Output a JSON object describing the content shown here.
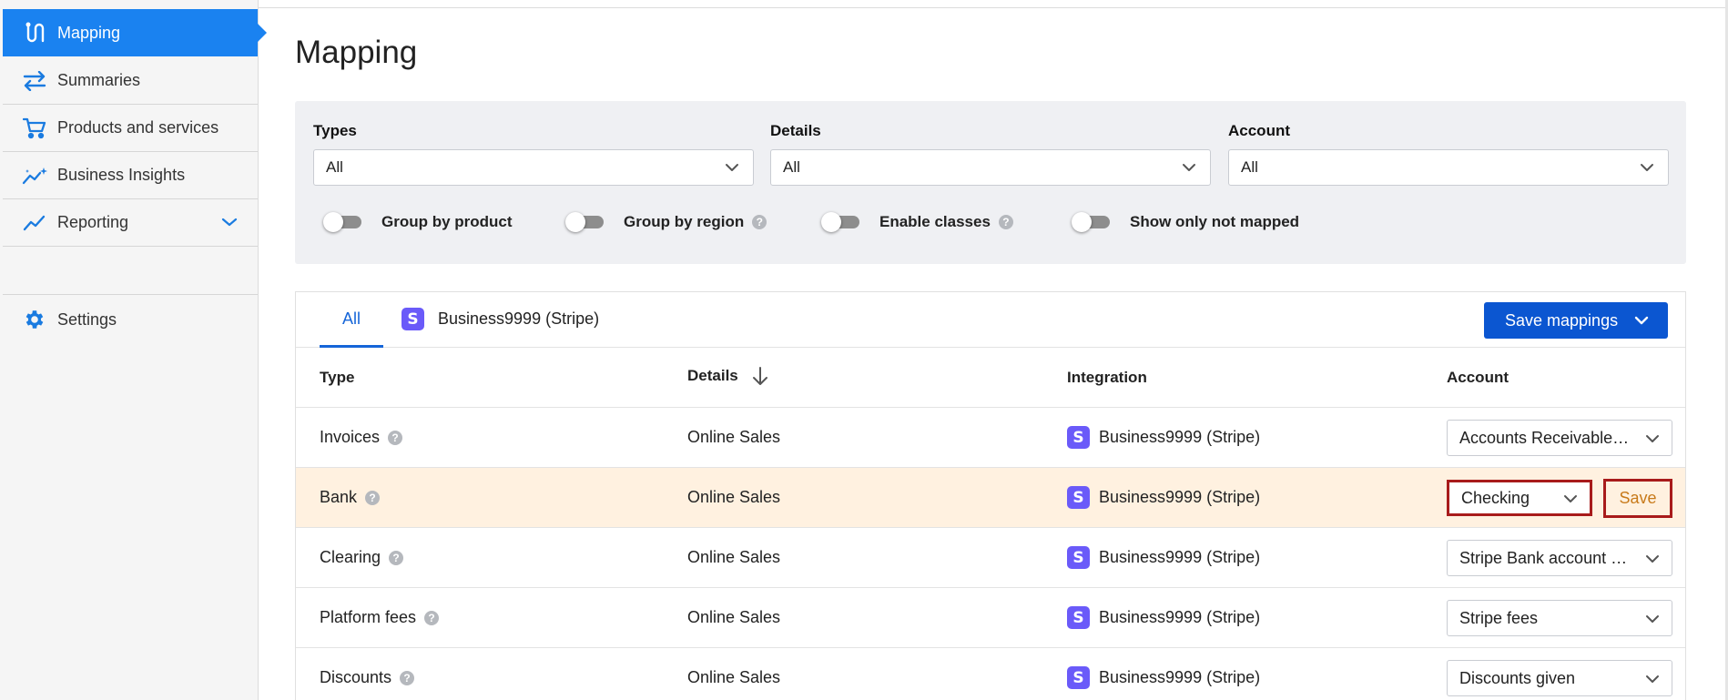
{
  "sidebar": {
    "items": [
      {
        "label": "Mapping",
        "icon": "mapping-route-icon",
        "active": true
      },
      {
        "label": "Summaries",
        "icon": "swap-arrows-icon"
      },
      {
        "label": "Products and services",
        "icon": "cart-icon"
      },
      {
        "label": "Business Insights",
        "icon": "sparkle-chart-icon"
      },
      {
        "label": "Reporting",
        "icon": "trend-line-icon",
        "expandable": true
      },
      {
        "label": "Settings",
        "icon": "gear-icon"
      }
    ]
  },
  "page": {
    "title": "Mapping"
  },
  "filters": {
    "types": {
      "label": "Types",
      "value": "All"
    },
    "details": {
      "label": "Details",
      "value": "All"
    },
    "account": {
      "label": "Account",
      "value": "All"
    },
    "toggles": [
      {
        "label": "Group by product",
        "on": false,
        "help": false
      },
      {
        "label": "Group by region",
        "on": false,
        "help": true
      },
      {
        "label": "Enable classes",
        "on": false,
        "help": true
      },
      {
        "label": "Show only not mapped",
        "on": false,
        "help": false
      }
    ],
    "help_glyph": "?"
  },
  "tabs": {
    "all": "All",
    "integration": "Business9999 (Stripe)",
    "stripe_glyph": "S"
  },
  "save_mappings": {
    "label": "Save mappings"
  },
  "table": {
    "headers": {
      "type": "Type",
      "details": "Details",
      "integration": "Integration",
      "account": "Account"
    },
    "rows": [
      {
        "type": "Invoices",
        "details": "Online Sales",
        "integration": "Business9999 (Stripe)",
        "account": "Accounts Receivable (A/R)"
      },
      {
        "type": "Bank",
        "details": "Online Sales",
        "integration": "Business9999 (Stripe)",
        "account": "Checking",
        "save_label": "Save",
        "modified": true
      },
      {
        "type": "Clearing",
        "details": "Online Sales",
        "integration": "Business9999 (Stripe)",
        "account": "Stripe Bank account (restricted)"
      },
      {
        "type": "Platform fees",
        "details": "Online Sales",
        "integration": "Business9999 (Stripe)",
        "account": "Stripe fees"
      },
      {
        "type": "Discounts",
        "details": "Online Sales",
        "integration": "Business9999 (Stripe)",
        "account": "Discounts given"
      }
    ]
  },
  "colors": {
    "primary": "#1a82f0",
    "button": "#0b56d1",
    "stripe": "#6a5af9",
    "highlight_row": "#fff1e0",
    "alert_border": "#a81b1b",
    "save_text": "#c87a1a"
  }
}
